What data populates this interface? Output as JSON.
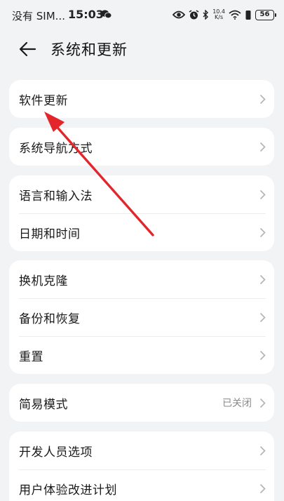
{
  "status_bar": {
    "carrier": "没有 SIM...",
    "time": "15:03",
    "net_speed_top": "10.4",
    "net_speed_bottom": "K/s",
    "battery": "56",
    "icons": [
      "chat-icon",
      "eye-icon",
      "alarm-icon",
      "bluetooth-icon",
      "wifi-icon",
      "vibrate-icon",
      "battery-icon"
    ]
  },
  "header": {
    "back_icon": "back-arrow-icon",
    "title": "系统和更新"
  },
  "groups": [
    {
      "items": [
        {
          "label": "软件更新",
          "value": ""
        }
      ]
    },
    {
      "items": [
        {
          "label": "系统导航方式",
          "value": ""
        }
      ]
    },
    {
      "items": [
        {
          "label": "语言和输入法",
          "value": ""
        },
        {
          "label": "日期和时间",
          "value": ""
        }
      ]
    },
    {
      "items": [
        {
          "label": "换机克隆",
          "value": ""
        },
        {
          "label": "备份和恢复",
          "value": ""
        },
        {
          "label": "重置",
          "value": ""
        }
      ]
    },
    {
      "items": [
        {
          "label": "简易模式",
          "value": "已关闭"
        }
      ]
    },
    {
      "items": [
        {
          "label": "开发人员选项",
          "value": ""
        },
        {
          "label": "用户体验改进计划",
          "value": ""
        }
      ]
    }
  ],
  "annotation": {
    "color": "#e3262b",
    "icon": "red-arrow-icon"
  }
}
